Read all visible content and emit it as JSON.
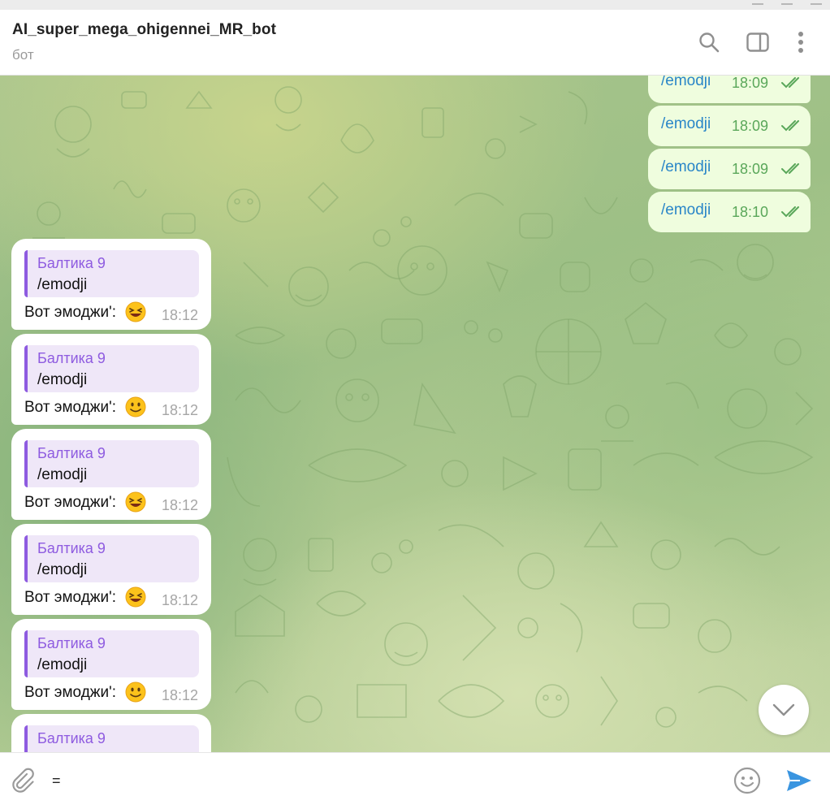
{
  "header": {
    "title": "AI_super_mega_ohigennei_MR_bot",
    "subtitle": "бот",
    "icons": [
      "search-icon",
      "sidebar-toggle-icon",
      "more-vertical-icon"
    ]
  },
  "outgoing": [
    {
      "text": "/emodji",
      "time": "18:09"
    },
    {
      "text": "/emodji",
      "time": "18:09"
    },
    {
      "text": "/emodji",
      "time": "18:09"
    },
    {
      "text": "/emodji",
      "time": "18:10"
    }
  ],
  "incoming": [
    {
      "reply_name": "Балтика 9",
      "reply_text": "/emodji",
      "text": "Вот эмоджи':",
      "emoji": "😆",
      "time": "18:12"
    },
    {
      "reply_name": "Балтика 9",
      "reply_text": "/emodji",
      "text": "Вот эмоджи':",
      "emoji": "🙂",
      "time": "18:12"
    },
    {
      "reply_name": "Балтика 9",
      "reply_text": "/emodji",
      "text": "Вот эмоджи':",
      "emoji": "😆",
      "time": "18:12"
    },
    {
      "reply_name": "Балтика 9",
      "reply_text": "/emodji",
      "text": "Вот эмоджи':",
      "emoji": "😆",
      "time": "18:12"
    },
    {
      "reply_name": "Балтика 9",
      "reply_text": "/emodji",
      "text": "Вот эмоджи':",
      "emoji": "🙂",
      "time": "18:12"
    },
    {
      "reply_name": "Балтика 9"
    }
  ],
  "composer": {
    "value": "=",
    "icons": [
      "paperclip-icon",
      "emoji-icon",
      "send-icon"
    ]
  },
  "colors": {
    "outgoing_bubble": "#effdde",
    "outgoing_text": "#2a86c8",
    "outgoing_time": "#5aa75a",
    "reply_accent": "#8e5be0",
    "reply_bg": "#efe7f8",
    "send_icon": "#3a95e0"
  }
}
